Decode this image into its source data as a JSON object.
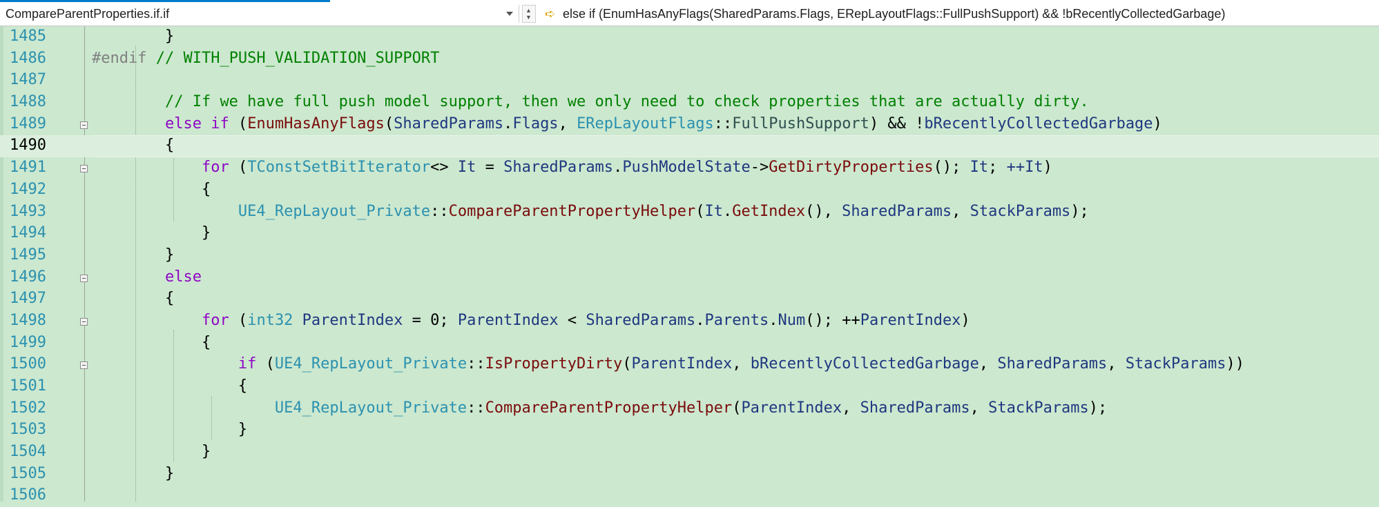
{
  "navbar": {
    "scope": "CompareParentProperties.if.if",
    "member": "else if (EnumHasAnyFlags(SharedParams.Flags, ERepLayoutFlags::FullPushSupport) && !bRecentlyCollectedGarbage)"
  },
  "colors": {
    "editor_background": "#cce8cf",
    "line_number": "#2b91af",
    "comment": "#008000",
    "keyword": "#8f08c4",
    "type": "#2b91af",
    "function": "#7a0b0b",
    "variable": "#1f377f"
  },
  "current_line": "1490",
  "lines": [
    {
      "n": "1485",
      "fold": false,
      "tokens": [
        [
          "",
          "        }"
        ]
      ]
    },
    {
      "n": "1486",
      "fold": false,
      "tokens": [
        [
          "pp",
          "#endif"
        ],
        [
          "",
          ""
        ],
        [
          "cm",
          " // WITH_PUSH_VALIDATION_SUPPORT"
        ]
      ]
    },
    {
      "n": "1487",
      "fold": false,
      "tokens": []
    },
    {
      "n": "1488",
      "fold": false,
      "tokens": [
        [
          "",
          "        "
        ],
        [
          "cm",
          "// If we have full push model support, then we only need to check properties that are actually dirty."
        ]
      ]
    },
    {
      "n": "1489",
      "fold": true,
      "tokens": [
        [
          "",
          "        "
        ],
        [
          "kw",
          "else if"
        ],
        [
          "",
          " ("
        ],
        [
          "fnr",
          "EnumHasAnyFlags"
        ],
        [
          "",
          "("
        ],
        [
          "var",
          "SharedParams"
        ],
        [
          "",
          "."
        ],
        [
          "mem",
          "Flags"
        ],
        [
          "",
          ", "
        ],
        [
          "ty",
          "ERepLayoutFlags"
        ],
        [
          "",
          "::"
        ],
        [
          "en",
          "FullPushSupport"
        ],
        [
          "",
          ") && !"
        ],
        [
          "var",
          "bRecentlyCollectedGarbage"
        ],
        [
          "",
          ")"
        ]
      ]
    },
    {
      "n": "1490",
      "fold": false,
      "tokens": [
        [
          "",
          "        {"
        ]
      ]
    },
    {
      "n": "1491",
      "fold": true,
      "tokens": [
        [
          "",
          "            "
        ],
        [
          "kw",
          "for"
        ],
        [
          "",
          " ("
        ],
        [
          "ty",
          "TConstSetBitIterator"
        ],
        [
          "",
          "<> "
        ],
        [
          "var",
          "It"
        ],
        [
          "",
          " = "
        ],
        [
          "var",
          "SharedParams"
        ],
        [
          "",
          "."
        ],
        [
          "mem",
          "PushModelState"
        ],
        [
          "",
          "->"
        ],
        [
          "fnr",
          "GetDirtyProperties"
        ],
        [
          "",
          "(); "
        ],
        [
          "var",
          "It"
        ],
        [
          "",
          "; "
        ],
        [
          "var",
          "++It"
        ],
        [
          "",
          ")"
        ]
      ]
    },
    {
      "n": "1492",
      "fold": false,
      "tokens": [
        [
          "",
          "            {"
        ]
      ]
    },
    {
      "n": "1493",
      "fold": false,
      "tokens": [
        [
          "",
          "                "
        ],
        [
          "ns",
          "UE4_RepLayout_Private"
        ],
        [
          "",
          "::"
        ],
        [
          "fnr",
          "CompareParentPropertyHelper"
        ],
        [
          "",
          "("
        ],
        [
          "var",
          "It"
        ],
        [
          "",
          "."
        ],
        [
          "fnr",
          "GetIndex"
        ],
        [
          "",
          "(), "
        ],
        [
          "var",
          "SharedParams"
        ],
        [
          "",
          ", "
        ],
        [
          "var",
          "StackParams"
        ],
        [
          "",
          ");"
        ]
      ]
    },
    {
      "n": "1494",
      "fold": false,
      "tokens": [
        [
          "",
          "            }"
        ]
      ]
    },
    {
      "n": "1495",
      "fold": false,
      "tokens": [
        [
          "",
          "        }"
        ]
      ]
    },
    {
      "n": "1496",
      "fold": true,
      "tokens": [
        [
          "",
          "        "
        ],
        [
          "kw",
          "else"
        ]
      ]
    },
    {
      "n": "1497",
      "fold": false,
      "tokens": [
        [
          "",
          "        {"
        ]
      ]
    },
    {
      "n": "1498",
      "fold": true,
      "tokens": [
        [
          "",
          "            "
        ],
        [
          "kw",
          "for"
        ],
        [
          "",
          " ("
        ],
        [
          "ty",
          "int32"
        ],
        [
          "",
          ""
        ],
        [
          "var",
          " ParentIndex"
        ],
        [
          "",
          " = 0; "
        ],
        [
          "var",
          "ParentIndex"
        ],
        [
          "",
          " < "
        ],
        [
          "var",
          "SharedParams"
        ],
        [
          "",
          "."
        ],
        [
          "mem",
          "Parents"
        ],
        [
          "",
          "."
        ],
        [
          "mem",
          "Num"
        ],
        [
          "",
          "(); ++"
        ],
        [
          "var",
          "ParentIndex"
        ],
        [
          "",
          ")"
        ]
      ]
    },
    {
      "n": "1499",
      "fold": false,
      "tokens": [
        [
          "",
          "            {"
        ]
      ]
    },
    {
      "n": "1500",
      "fold": true,
      "tokens": [
        [
          "",
          "                "
        ],
        [
          "kw",
          "if"
        ],
        [
          "",
          " ("
        ],
        [
          "ns",
          "UE4_RepLayout_Private"
        ],
        [
          "",
          "::"
        ],
        [
          "fnr",
          "IsPropertyDirty"
        ],
        [
          "",
          "("
        ],
        [
          "var",
          "ParentIndex"
        ],
        [
          "",
          ", "
        ],
        [
          "var",
          "bRecentlyCollectedGarbage"
        ],
        [
          "",
          ", "
        ],
        [
          "var",
          "SharedParams"
        ],
        [
          "",
          ", "
        ],
        [
          "var",
          "StackParams"
        ],
        [
          "",
          "))"
        ]
      ]
    },
    {
      "n": "1501",
      "fold": false,
      "tokens": [
        [
          "",
          "                {"
        ]
      ]
    },
    {
      "n": "1502",
      "fold": false,
      "tokens": [
        [
          "",
          "                    "
        ],
        [
          "ns",
          "UE4_RepLayout_Private"
        ],
        [
          "",
          "::"
        ],
        [
          "fnr",
          "CompareParentPropertyHelper"
        ],
        [
          "",
          "("
        ],
        [
          "var",
          "ParentIndex"
        ],
        [
          "",
          ", "
        ],
        [
          "var",
          "SharedParams"
        ],
        [
          "",
          ", "
        ],
        [
          "var",
          "StackParams"
        ],
        [
          "",
          ");"
        ]
      ]
    },
    {
      "n": "1503",
      "fold": false,
      "tokens": [
        [
          "",
          "                }"
        ]
      ]
    },
    {
      "n": "1504",
      "fold": false,
      "tokens": [
        [
          "",
          "            }"
        ]
      ]
    },
    {
      "n": "1505",
      "fold": false,
      "tokens": [
        [
          "",
          "        }"
        ]
      ]
    },
    {
      "n": "1506",
      "fold": false,
      "tokens": []
    }
  ]
}
